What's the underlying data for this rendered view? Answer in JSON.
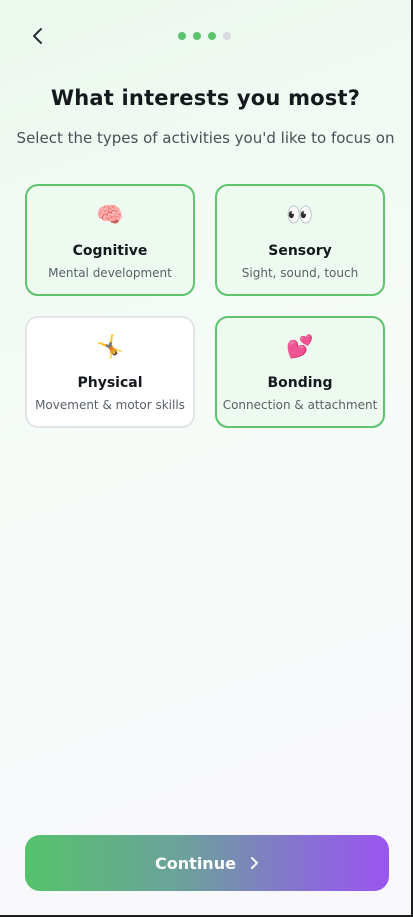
{
  "progress": {
    "total_steps": 4,
    "current_step": 3
  },
  "header": {
    "title": "What interests you most?",
    "subtitle": "Select the types of activities you'd like to focus on"
  },
  "options": [
    {
      "emoji": "🧠",
      "icon": "brain-icon",
      "title": "Cognitive",
      "description": "Mental development",
      "selected": true
    },
    {
      "emoji": "👀",
      "icon": "eyes-icon",
      "title": "Sensory",
      "description": "Sight, sound, touch",
      "selected": true
    },
    {
      "emoji": "🤸",
      "icon": "cartwheel-icon",
      "title": "Physical",
      "description": "Movement & motor skills",
      "selected": false
    },
    {
      "emoji": "💕",
      "icon": "two-hearts-icon",
      "title": "Bonding",
      "description": "Connection & attachment",
      "selected": true
    }
  ],
  "footer": {
    "continue_label": "Continue"
  },
  "colors": {
    "accent_green": "#5bc46d",
    "accent_purple": "#9a55ee",
    "selected_card_bg": "#eefaef",
    "dot_inactive": "#d7dbe0"
  }
}
